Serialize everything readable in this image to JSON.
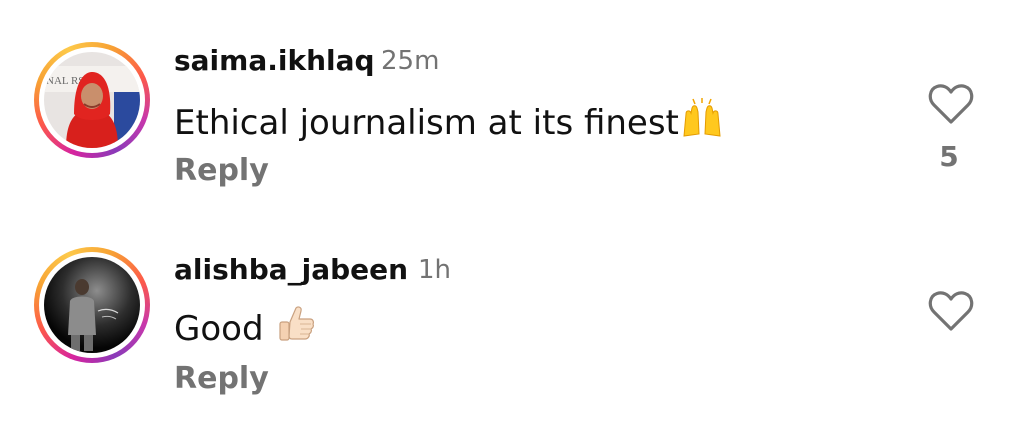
{
  "comments": [
    {
      "username": "saima.ikhlaq",
      "time": "25m",
      "text": "Ethical journalism at its finest",
      "emoji": "raising-hands",
      "reply_label": "Reply",
      "like_count": "5",
      "avatar_banner_text": "NAL   RST"
    },
    {
      "username": "alishba_jabeen",
      "time": "1h",
      "text": "Good ",
      "emoji": "thumbs-up",
      "reply_label": "Reply",
      "like_count": ""
    }
  ],
  "colors": {
    "text": "#111111",
    "muted": "#737373",
    "ring_gradient": [
      "#d6249f",
      "#fd5949",
      "#fdc94a",
      "#8a3ab9"
    ]
  },
  "icons": [
    "heart-outline-icon",
    "raising-hands-emoji",
    "thumbs-up-emoji"
  ]
}
